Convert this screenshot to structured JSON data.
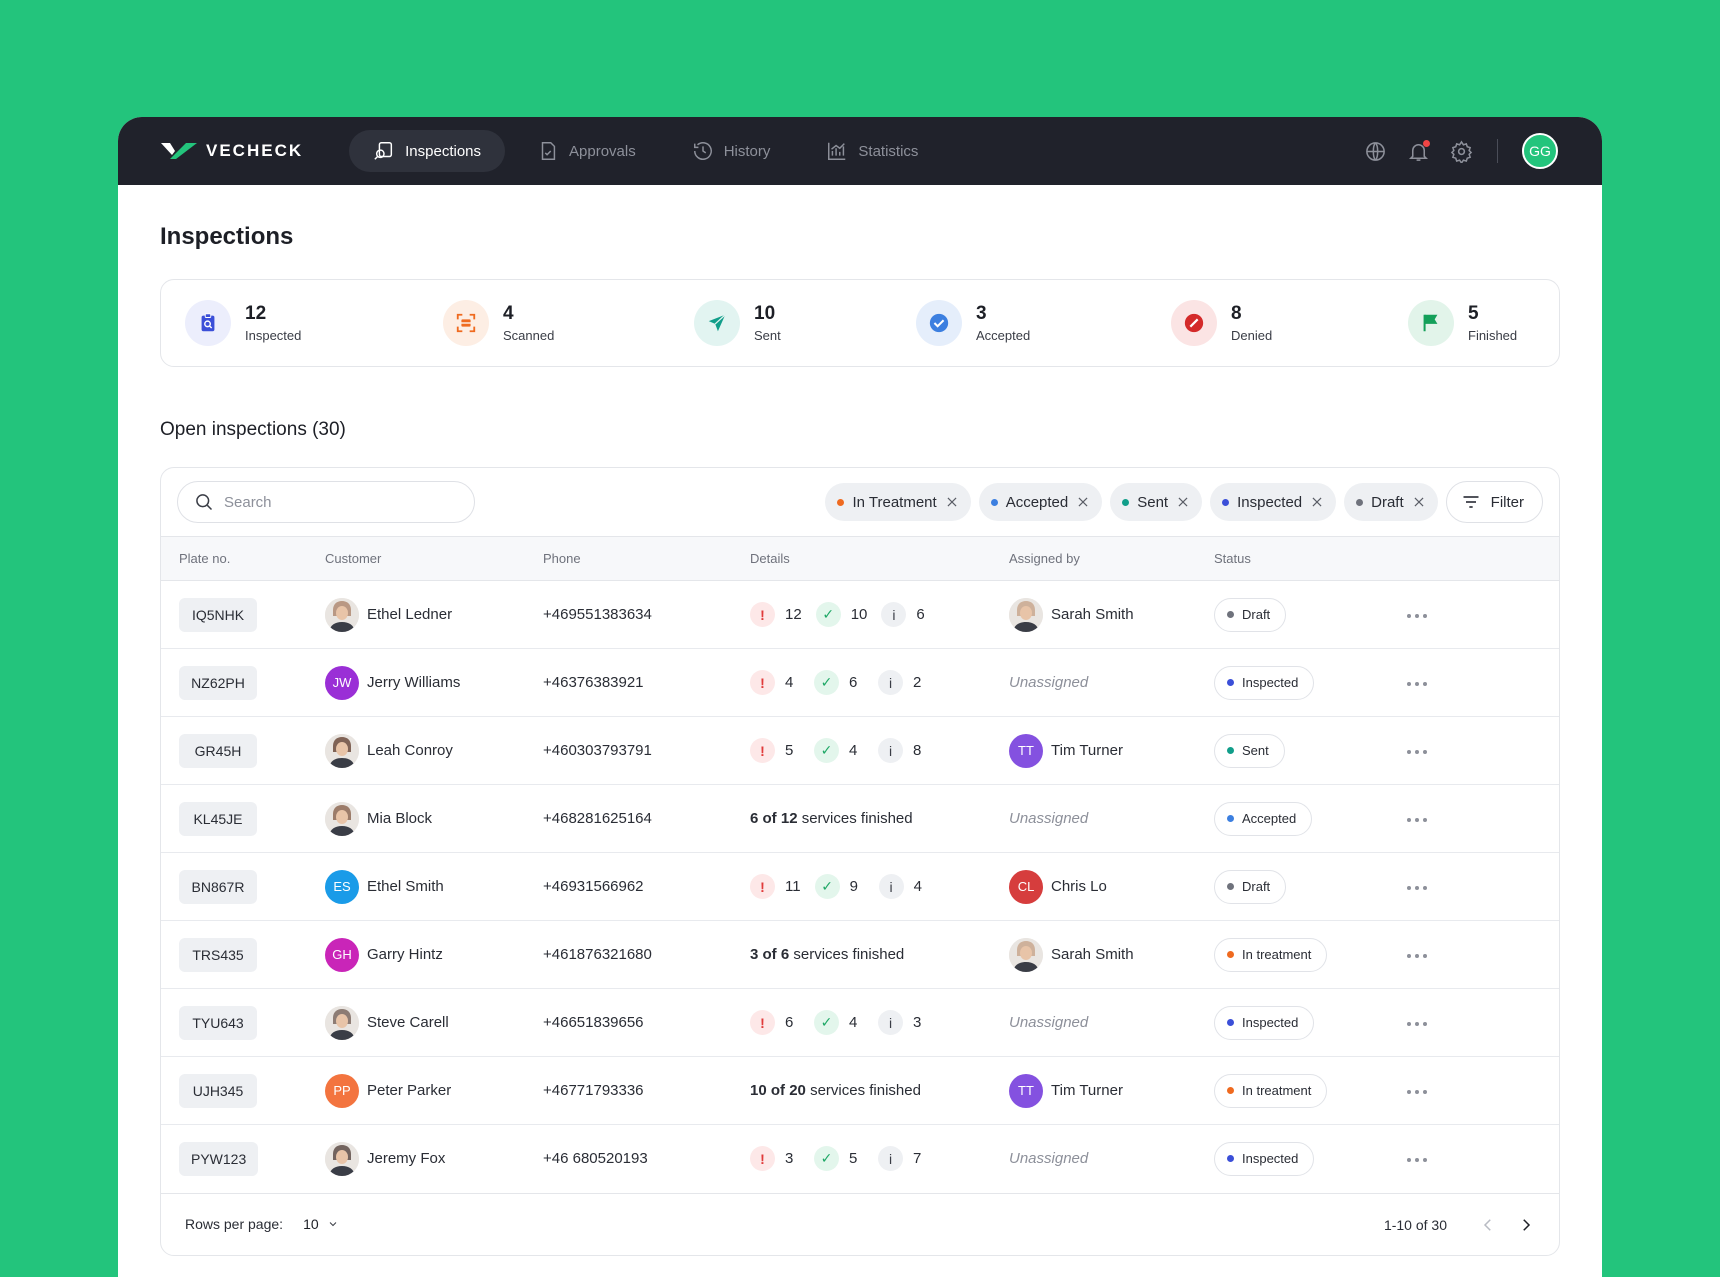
{
  "app": {
    "brand": "VECHECK",
    "nav": [
      {
        "label": "Inspections",
        "icon": "inspection-icon",
        "active": true
      },
      {
        "label": "Approvals",
        "icon": "document-check-icon",
        "active": false
      },
      {
        "label": "History",
        "icon": "history-icon",
        "active": false
      },
      {
        "label": "Statistics",
        "icon": "chart-icon",
        "active": false
      }
    ],
    "user_initials": "GG"
  },
  "page": {
    "title": "Inspections",
    "section_title": "Open inspections (30)"
  },
  "stats": [
    {
      "value": "12",
      "label": "Inspected",
      "icon": "clipboard-search-icon",
      "color": "#3b4fd8",
      "bg": "#eceefc"
    },
    {
      "value": "4",
      "label": "Scanned",
      "icon": "scan-icon",
      "color": "#ef6a1f",
      "bg": "#fdeee4"
    },
    {
      "value": "10",
      "label": "Sent",
      "icon": "send-icon",
      "color": "#119e8a",
      "bg": "#e2f4f1"
    },
    {
      "value": "3",
      "label": "Accepted",
      "icon": "check-circle-icon",
      "color": "#3c7fe0",
      "bg": "#e5eefb"
    },
    {
      "value": "8",
      "label": "Denied",
      "icon": "denied-icon",
      "color": "#d42a2a",
      "bg": "#fbe4e4"
    },
    {
      "value": "5",
      "label": "Finished",
      "icon": "flag-icon",
      "color": "#14a05a",
      "bg": "#e2f4ea"
    }
  ],
  "toolbar": {
    "search_placeholder": "Search",
    "chips": [
      {
        "label": "In Treatment",
        "color": "#ef6a1f"
      },
      {
        "label": "Accepted",
        "color": "#3c7fe0"
      },
      {
        "label": "Sent",
        "color": "#119e8a"
      },
      {
        "label": "Inspected",
        "color": "#3b4fd8"
      },
      {
        "label": "Draft",
        "color": "#6f727c"
      }
    ],
    "filter_label": "Filter"
  },
  "table": {
    "headers": [
      "Plate no.",
      "Customer",
      "Phone",
      "Details",
      "Assigned by",
      "Status"
    ],
    "rows": [
      {
        "plate": "IQ5NHK",
        "customer": "Ethel Ledner",
        "cust_initials": "",
        "cust_color": "#b08b73",
        "phone": "+469551383634",
        "warn": "12",
        "ok": "10",
        "info": "6",
        "services_done": "",
        "services_total": "",
        "assignee": "Sarah Smith",
        "assignee_initials": "",
        "assignee_color": "#c9a88e",
        "status": "Draft",
        "status_color": "#6f727c"
      },
      {
        "plate": "NZ62PH",
        "customer": "Jerry Williams",
        "cust_initials": "JW",
        "cust_color": "#9a2fd6",
        "phone": "+46376383921",
        "warn": "4",
        "ok": "6",
        "info": "2",
        "services_done": "",
        "services_total": "",
        "assignee": "Unassigned",
        "assignee_initials": "",
        "assignee_color": "",
        "status": "Inspected",
        "status_color": "#3b4fd8"
      },
      {
        "plate": "GR45H",
        "customer": "Leah Conroy",
        "cust_initials": "",
        "cust_color": "#6d4c3d",
        "phone": "+460303793791",
        "warn": "5",
        "ok": "4",
        "info": "8",
        "services_done": "",
        "services_total": "",
        "assignee": "Tim Turner",
        "assignee_initials": "TT",
        "assignee_color": "#8451e0",
        "status": "Sent",
        "status_color": "#119e8a"
      },
      {
        "plate": "KL45JE",
        "customer": "Mia Block",
        "cust_initials": "",
        "cust_color": "#8e6a55",
        "phone": "+468281625164",
        "warn": "",
        "ok": "",
        "info": "",
        "services_done": "6",
        "services_total": "12",
        "assignee": "Unassigned",
        "assignee_initials": "",
        "assignee_color": "",
        "status": "Accepted",
        "status_color": "#3c7fe0"
      },
      {
        "plate": "BN867R",
        "customer": "Ethel Smith",
        "cust_initials": "ES",
        "cust_color": "#1a9be8",
        "phone": "+46931566962",
        "warn": "11",
        "ok": "9",
        "info": "4",
        "services_done": "",
        "services_total": "",
        "assignee": "Chris Lo",
        "assignee_initials": "CL",
        "assignee_color": "#d63d3d",
        "status": "Draft",
        "status_color": "#6f727c"
      },
      {
        "plate": "TRS435",
        "customer": "Garry Hintz",
        "cust_initials": "GH",
        "cust_color": "#c925b8",
        "phone": "+461876321680",
        "warn": "",
        "ok": "",
        "info": "",
        "services_done": "3",
        "services_total": "6",
        "assignee": "Sarah Smith",
        "assignee_initials": "",
        "assignee_color": "#c9a88e",
        "status": "In treatment",
        "status_color": "#ef6a1f"
      },
      {
        "plate": "TYU643",
        "customer": "Steve Carell",
        "cust_initials": "",
        "cust_color": "#7d6a60",
        "phone": "+46651839656",
        "warn": "6",
        "ok": "4",
        "info": "3",
        "services_done": "",
        "services_total": "",
        "assignee": "Unassigned",
        "assignee_initials": "",
        "assignee_color": "",
        "status": "Inspected",
        "status_color": "#3b4fd8"
      },
      {
        "plate": "UJH345",
        "customer": "Peter Parker",
        "cust_initials": "PP",
        "cust_color": "#f3743f",
        "phone": "+46771793336",
        "warn": "",
        "ok": "",
        "info": "",
        "services_done": "10",
        "services_total": "20",
        "assignee": "Tim Turner",
        "assignee_initials": "TT",
        "assignee_color": "#8451e0",
        "status": "In treatment",
        "status_color": "#ef6a1f"
      },
      {
        "plate": "PYW123",
        "customer": "Jeremy Fox",
        "cust_initials": "",
        "cust_color": "#5e4e48",
        "phone": "+46 680520193",
        "warn": "3",
        "ok": "5",
        "info": "7",
        "services_done": "",
        "services_total": "",
        "assignee": "Unassigned",
        "assignee_initials": "",
        "assignee_color": "",
        "status": "Inspected",
        "status_color": "#3b4fd8"
      }
    ],
    "services_of": "of",
    "services_suffix": "services finished"
  },
  "footer": {
    "rows_per_page_label": "Rows per page:",
    "rows_per_page": "10",
    "range": "1-10 of 30"
  }
}
